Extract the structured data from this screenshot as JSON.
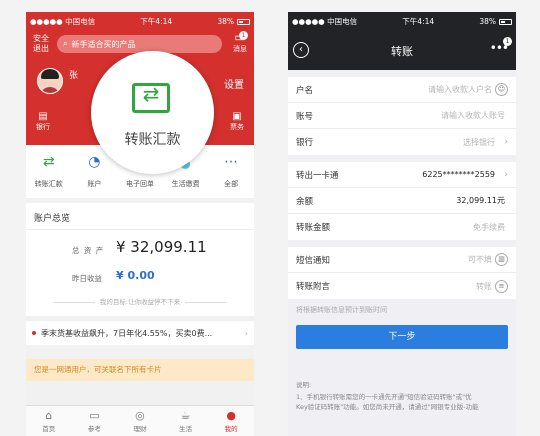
{
  "left": {
    "status": {
      "carrier": "●●●●● 中国电信",
      "time": "下午4:14",
      "battery": "38%"
    },
    "header": {
      "safe_exit": [
        "安全",
        "退出"
      ],
      "search_placeholder": "新手适合买的产品",
      "msg_label": "消息",
      "msg_badge": "1",
      "user_name": "张",
      "settings": "设置",
      "quick": [
        "银行",
        "票务"
      ]
    },
    "bubble": {
      "label": "转账汇款"
    },
    "grid": [
      {
        "label": "转账汇款",
        "icon": "transfer-icon"
      },
      {
        "label": "账户",
        "icon": "pie-chart-icon"
      },
      {
        "label": "电子回单",
        "icon": "document-icon"
      },
      {
        "label": "生活缴费",
        "icon": "water-drop-icon"
      },
      {
        "label": "全部",
        "icon": "more-dots-icon"
      }
    ],
    "account": {
      "title": "账户总览",
      "total_label": "总 资 产",
      "total_value": "¥ 32,099.11",
      "yesterday_label": "昨日收益",
      "yesterday_value": "¥ 0.00",
      "goal": "我的目标:让你收益停不下来"
    },
    "news": "季末货基收益飙升，7日年化4.55%，买卖0费...",
    "notice": "您是一网通用户，可关联名下所有卡片",
    "tabs": [
      {
        "label": "首页",
        "icon": "home-icon"
      },
      {
        "label": "参考",
        "icon": "reference-icon"
      },
      {
        "label": "理财",
        "icon": "finance-icon"
      },
      {
        "label": "生活",
        "icon": "life-icon"
      },
      {
        "label": "我的",
        "icon": "user-icon",
        "active": true
      }
    ]
  },
  "right": {
    "status": {
      "carrier": "●●●●● 中国电信",
      "time": "下午4:14",
      "battery": "38%"
    },
    "title": "转账",
    "badge": "1",
    "payee": [
      {
        "label": "户名",
        "placeholder": "请输入收款人户名",
        "icon": "contact-icon"
      },
      {
        "label": "账号",
        "placeholder": "请输入收款人账号"
      },
      {
        "label": "银行",
        "placeholder": "选择银行",
        "chevron": true
      }
    ],
    "payer": [
      {
        "label": "转出一卡通",
        "value": "6225********2559",
        "chevron": true
      },
      {
        "label": "余额",
        "value": "32,099.11元"
      },
      {
        "label": "转账金额",
        "placeholder": "免手续费"
      }
    ],
    "extra": [
      {
        "label": "短信通知",
        "placeholder": "可不填",
        "icon": "contacts-book-icon"
      },
      {
        "label": "转账附言",
        "placeholder": "转账",
        "icon": "list-icon"
      }
    ],
    "hint": "将根据转账信息预计到账时间",
    "next_button": "下一步",
    "note_title": "说明:",
    "note_lines": [
      "1、手机银行转账需您的一卡通先开通\"短信验证码转账\"或\"优",
      "Key验证码转账\"功能。如您尚未开通，请通过\"网银专业版-功能"
    ]
  }
}
